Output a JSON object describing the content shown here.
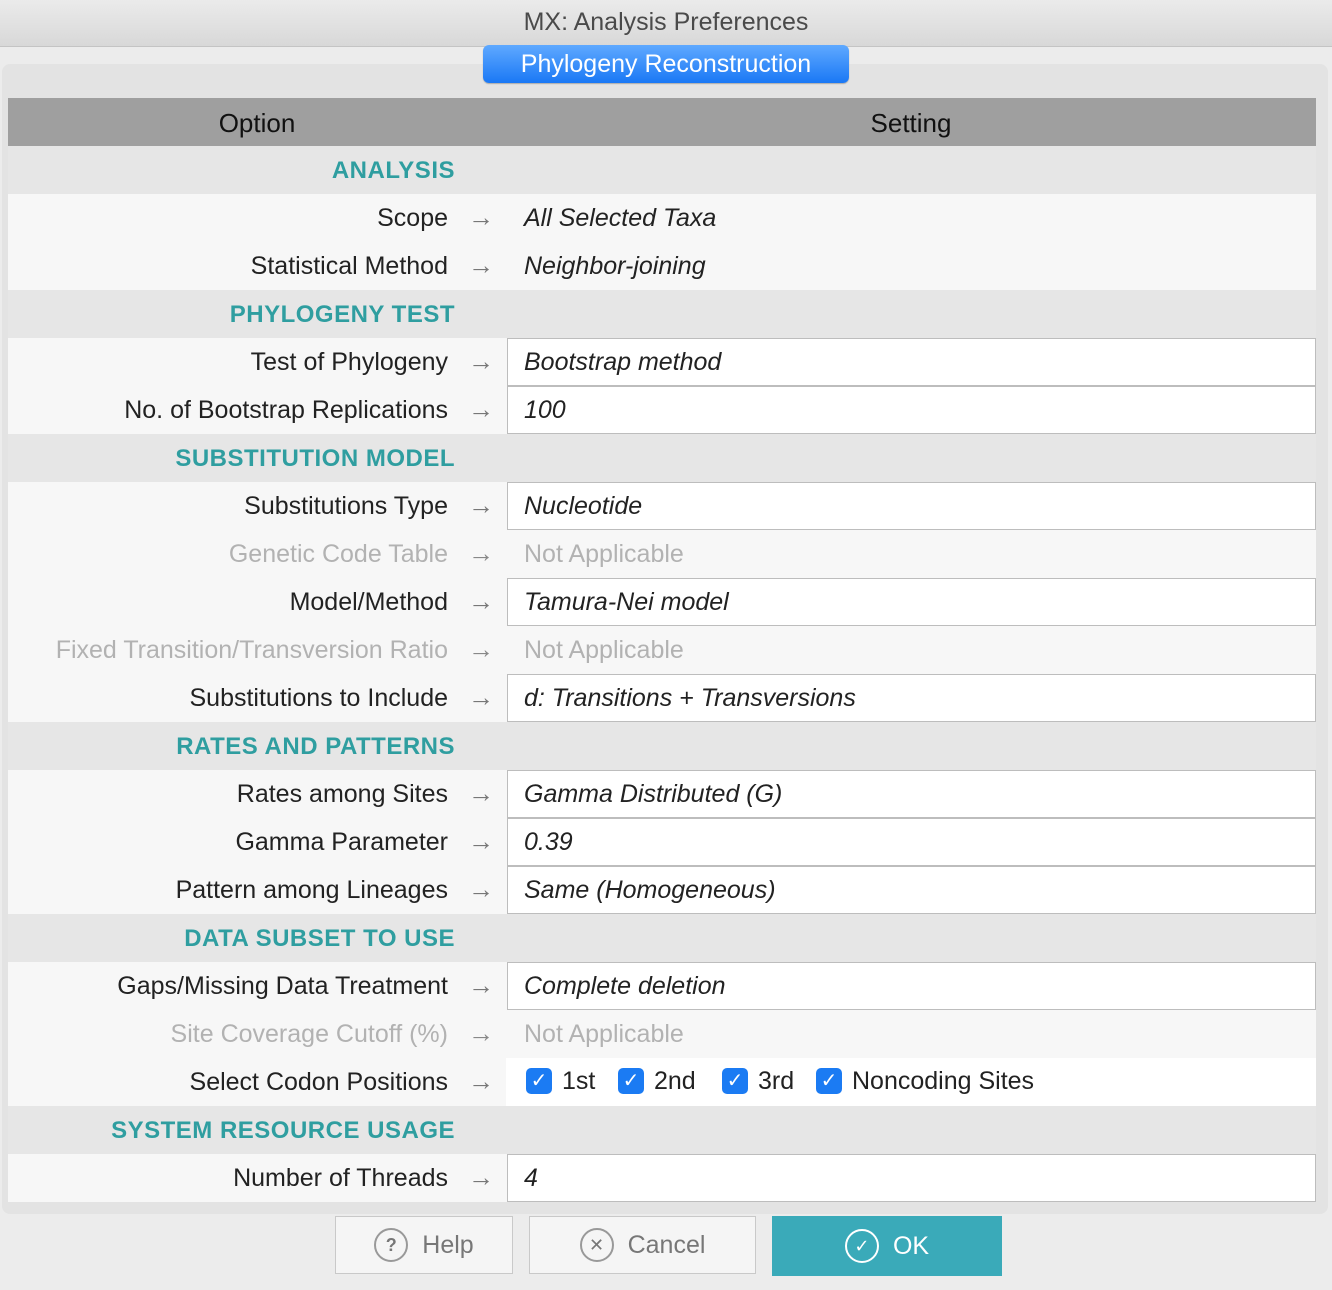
{
  "window": {
    "title": "MX: Analysis Preferences"
  },
  "tab": {
    "label": "Phylogeny Reconstruction"
  },
  "table": {
    "header": {
      "option": "Option",
      "setting": "Setting"
    },
    "sections": [
      {
        "label": "ANALYSIS",
        "rows": [
          {
            "option": "Scope",
            "value": "All Selected Taxa",
            "editable": false,
            "enabled": true
          },
          {
            "option": "Statistical Method",
            "value": "Neighbor-joining",
            "editable": false,
            "enabled": true
          }
        ]
      },
      {
        "label": "PHYLOGENY TEST",
        "rows": [
          {
            "option": "Test of Phylogeny",
            "value": "Bootstrap method",
            "editable": true,
            "enabled": true
          },
          {
            "option": "No. of Bootstrap Replications",
            "value": "100",
            "editable": true,
            "enabled": true
          }
        ]
      },
      {
        "label": "SUBSTITUTION MODEL",
        "rows": [
          {
            "option": "Substitutions Type",
            "value": "Nucleotide",
            "editable": true,
            "enabled": true
          },
          {
            "option": "Genetic Code Table",
            "value": "Not Applicable",
            "editable": false,
            "enabled": false
          },
          {
            "option": "Model/Method",
            "value": "Tamura-Nei model",
            "editable": true,
            "enabled": true
          },
          {
            "option": "Fixed Transition/Transversion Ratio",
            "value": "Not Applicable",
            "editable": false,
            "enabled": false
          },
          {
            "option": "Substitutions to Include",
            "value": "d: Transitions + Transversions",
            "editable": true,
            "enabled": true
          }
        ]
      },
      {
        "label": "RATES AND PATTERNS",
        "rows": [
          {
            "option": "Rates among Sites",
            "value": "Gamma Distributed (G)",
            "editable": true,
            "enabled": true
          },
          {
            "option": "Gamma Parameter",
            "value": "0.39",
            "editable": true,
            "enabled": true
          },
          {
            "option": "Pattern among Lineages",
            "value": "Same (Homogeneous)",
            "editable": true,
            "enabled": true
          }
        ]
      },
      {
        "label": "DATA SUBSET TO USE",
        "rows": [
          {
            "option": "Gaps/Missing Data Treatment",
            "value": "Complete deletion",
            "editable": true,
            "enabled": true
          },
          {
            "option": "Site Coverage Cutoff (%)",
            "value": "Not Applicable",
            "editable": false,
            "enabled": false
          },
          {
            "option": "Select Codon Positions",
            "codons": [
              {
                "label": "1st",
                "checked": true
              },
              {
                "label": "2nd",
                "checked": true
              },
              {
                "label": "3rd",
                "checked": true
              },
              {
                "label": "Noncoding Sites",
                "checked": true
              }
            ]
          }
        ]
      },
      {
        "label": "SYSTEM RESOURCE USAGE",
        "rows": [
          {
            "option": "Number of Threads",
            "value": "4",
            "editable": true,
            "enabled": true
          }
        ]
      }
    ]
  },
  "buttons": {
    "help": "Help",
    "cancel": "Cancel",
    "ok": "OK"
  },
  "icons": {
    "help": "question-icon",
    "cancel": "close-icon",
    "ok": "check-icon",
    "arrow": "right-arrow-icon"
  },
  "colors": {
    "section_label": "#2f9ea0",
    "tab": "#1a78f5",
    "ok_button": "#3aaab9",
    "checkbox": "#1b7bf3"
  }
}
